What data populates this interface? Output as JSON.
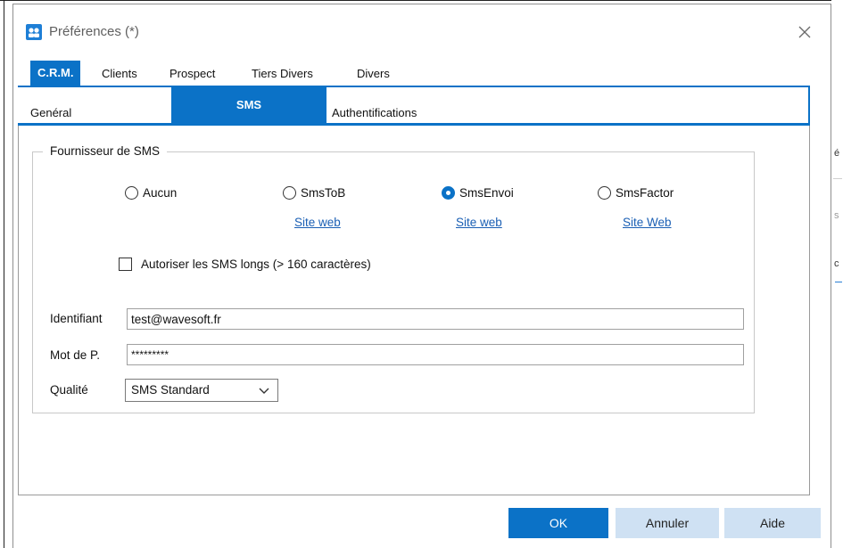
{
  "window": {
    "title": "Préférences (*)"
  },
  "main_tabs": [
    {
      "label": "C.R.M.",
      "active": true
    },
    {
      "label": "Clients",
      "active": false
    },
    {
      "label": "Prospect",
      "active": false
    },
    {
      "label": "Tiers Divers",
      "active": false
    },
    {
      "label": "Divers",
      "active": false
    }
  ],
  "sub_tabs": [
    {
      "label": "Genéral",
      "active": false
    },
    {
      "label": "SMS",
      "active": true
    },
    {
      "label": "Authentifications",
      "active": false
    }
  ],
  "sms_provider": {
    "group_title": "Fournisseur de SMS",
    "options": [
      {
        "label": "Aucun",
        "selected": false,
        "link": ""
      },
      {
        "label": "SmsToB",
        "selected": false,
        "link": "Site web"
      },
      {
        "label": "SmsEnvoi",
        "selected": true,
        "link": "Site web"
      },
      {
        "label": "SmsFactor",
        "selected": false,
        "link": "Site Web"
      }
    ],
    "long_sms": {
      "label": "Autoriser les SMS longs (> 160 caractères)",
      "checked": false
    }
  },
  "fields": {
    "identifiant": {
      "label": "Identifiant",
      "value": "test@wavesoft.fr"
    },
    "password": {
      "label": "Mot de P.",
      "value": "*********"
    },
    "quality": {
      "label": "Qualité",
      "value": "SMS Standard"
    }
  },
  "buttons": {
    "ok": "OK",
    "cancel": "Annuler",
    "help": "Aide"
  },
  "background_fragments": [
    "é",
    "s",
    "c"
  ],
  "colors": {
    "accent": "#0b72c7",
    "secondary_button": "#cfe1f3",
    "link": "#1a5fb4"
  }
}
